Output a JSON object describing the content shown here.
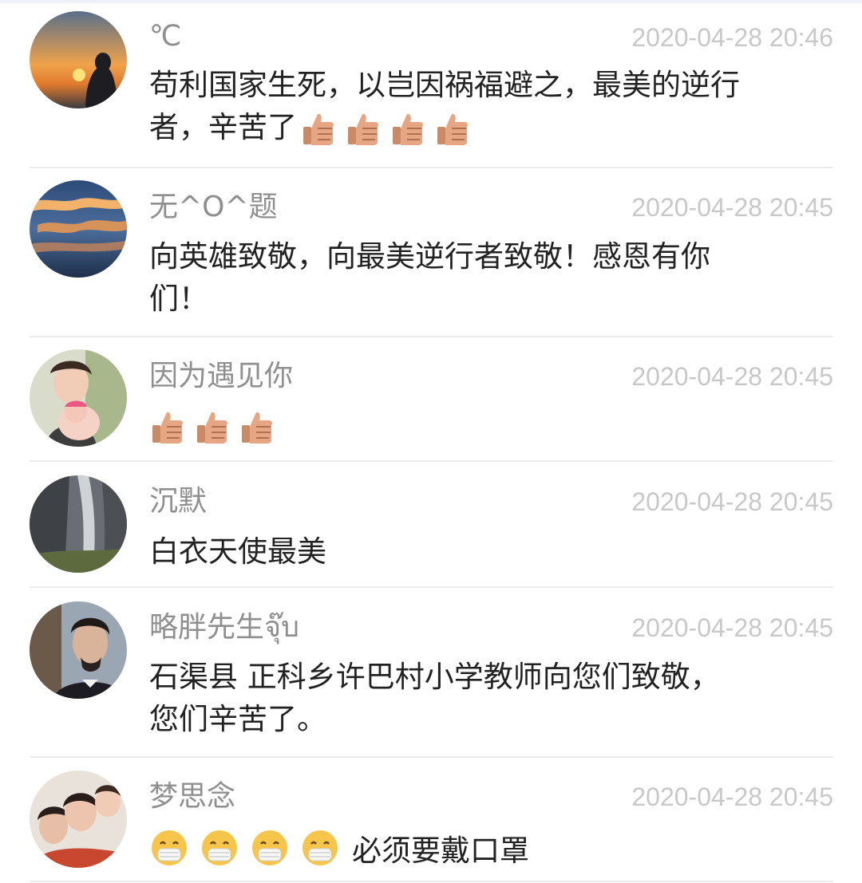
{
  "comments": [
    {
      "name": "℃",
      "time": "2020-04-28 20:46",
      "lines": [
        "苟利国家生死，以岂因祸福避之，最美的逆行",
        "者，辛苦了"
      ],
      "emoji": [
        "thumbs-up-icon",
        "thumbs-up-icon",
        "thumbs-up-icon",
        "thumbs-up-icon"
      ]
    },
    {
      "name": "无^O^题",
      "time": "2020-04-28 20:45",
      "lines": [
        "向英雄致敬，向最美逆行者致敬！感恩有你",
        "们！"
      ]
    },
    {
      "name": "因为遇见你",
      "time": "2020-04-28 20:45",
      "emoji": [
        "thumbs-up-icon",
        "thumbs-up-icon",
        "thumbs-up-icon"
      ]
    },
    {
      "name": "沉默",
      "time": "2020-04-28 20:45",
      "lines": [
        "白衣天使最美"
      ]
    },
    {
      "name": "略胖先生จุ๊บ",
      "time": "2020-04-28 20:45",
      "lines": [
        "石渠县 正科乡许巴村小学教师向您们致敬，",
        "您们辛苦了。"
      ]
    },
    {
      "name": "梦思念",
      "time": "2020-04-28 20:45",
      "lines": [
        "必须要戴口罩"
      ],
      "emoji": [
        "mask-face-icon",
        "mask-face-icon",
        "mask-face-icon",
        "mask-face-icon"
      ]
    }
  ]
}
